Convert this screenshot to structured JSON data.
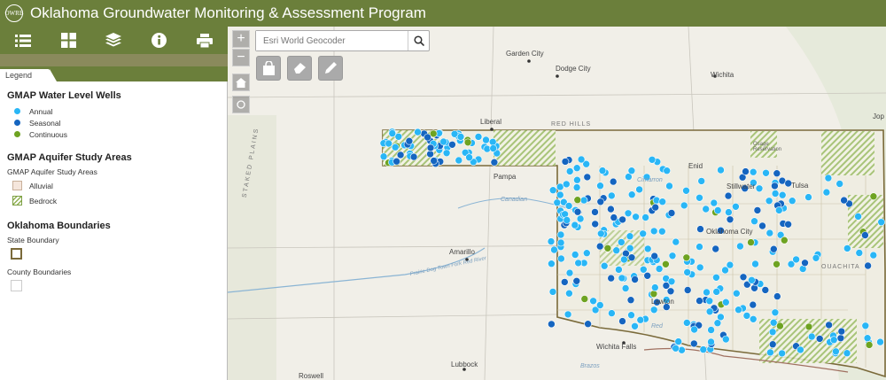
{
  "header": {
    "title": "Oklahoma Groundwater Monitoring & Assessment Program",
    "logo_text": "OWRB"
  },
  "toolbar": {
    "icons": [
      "list-icon",
      "grid-icon",
      "layers-icon",
      "info-icon",
      "print-icon"
    ]
  },
  "legend_tab": "Legend",
  "legend": {
    "wells": {
      "title": "GMAP Water Level Wells",
      "items": [
        {
          "label": "Annual",
          "color": "#29b6f6"
        },
        {
          "label": "Seasonal",
          "color": "#1565c0"
        },
        {
          "label": "Continuous",
          "color": "#6ea321"
        }
      ]
    },
    "aquifer": {
      "title": "GMAP Aquifer Study Areas",
      "sub": "GMAP Aquifer Study Areas",
      "items": [
        {
          "label": "Alluvial"
        },
        {
          "label": "Bedrock"
        }
      ]
    },
    "boundaries": {
      "title": "Oklahoma Boundaries",
      "state": "State Boundary",
      "county": "County Boundaries"
    }
  },
  "map": {
    "search_placeholder": "Esri World Geocoder",
    "zoom_in": "+",
    "zoom_out": "−",
    "places": [
      "Garden City",
      "Dodge City",
      "Wichita",
      "Liberal",
      "RED HILLS",
      "Canadian",
      "Amarillo",
      "Lubbock",
      "Wichita Falls",
      "Lawton",
      "Oklahoma City",
      "Stillwater",
      "Tulsa",
      "Enid",
      "Pampa",
      "Prairie Dog Town Fork Red River",
      "Cimarron",
      "Brazos",
      "Roswell",
      "Osage Reservation",
      "OUACHITA",
      "STAKED PLAINS",
      "Red",
      "Jop"
    ],
    "colors": {
      "annual": "#29b6f6",
      "seasonal": "#1565c0",
      "continuous": "#6ea321",
      "boundary": "#7a6a3a"
    }
  }
}
